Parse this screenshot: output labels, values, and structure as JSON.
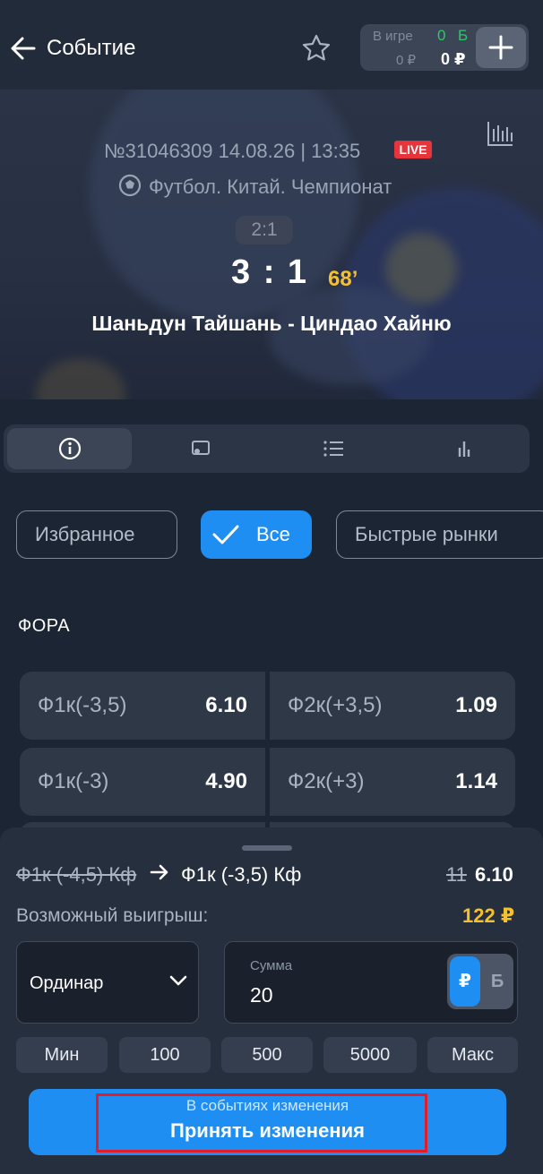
{
  "header": {
    "title": "Событие",
    "balance_label_top": "В игре",
    "balance_label_bottom": "0 ₽",
    "bonus_value": "0",
    "bonus_currency": "Б",
    "balance_value": "0 ₽"
  },
  "event": {
    "id_datetime": "№31046309 14.08.26 | 13:35",
    "live_badge": "LIVE",
    "league": "Футбол. Китай. Чемпионат",
    "previous_score": "2:1",
    "score": "3 : 1",
    "minute": "68’",
    "teams": "Шаньдун Тайшань - Циндао Хайню"
  },
  "filters": {
    "favorites": "Избранное",
    "all": "Все",
    "quick_markets": "Быстрые рынки"
  },
  "market": {
    "title": "ФОРА",
    "rows": [
      [
        {
          "label": "Ф1к(-3,5)",
          "odd": "6.10"
        },
        {
          "label": "Ф2к(+3,5)",
          "odd": "1.09"
        }
      ],
      [
        {
          "label": "Ф1к(-3)",
          "odd": "4.90"
        },
        {
          "label": "Ф2к(+3)",
          "odd": "1.14"
        }
      ]
    ]
  },
  "betslip": {
    "old_selection": "Ф1к (-4,5) Кф",
    "new_selection": "Ф1к (-3,5) Кф",
    "old_odd": "11",
    "new_odd": "6.10",
    "win_label": "Возможный выигрыш:",
    "win_value": "122 ₽",
    "bet_type": "Ординар",
    "amount_label": "Сумма",
    "amount_value": "20",
    "currency_rub": "₽",
    "currency_bonus": "Б",
    "quick_amounts": [
      "Мин",
      "100",
      "500",
      "5000",
      "Макс"
    ],
    "accept_sub": "В событиях изменения",
    "accept_main": "Принять изменения"
  },
  "colors": {
    "accent": "#1f8ef2",
    "live": "#e5353b",
    "win": "#f5c02e",
    "highlight_box": "#e11d2a"
  }
}
